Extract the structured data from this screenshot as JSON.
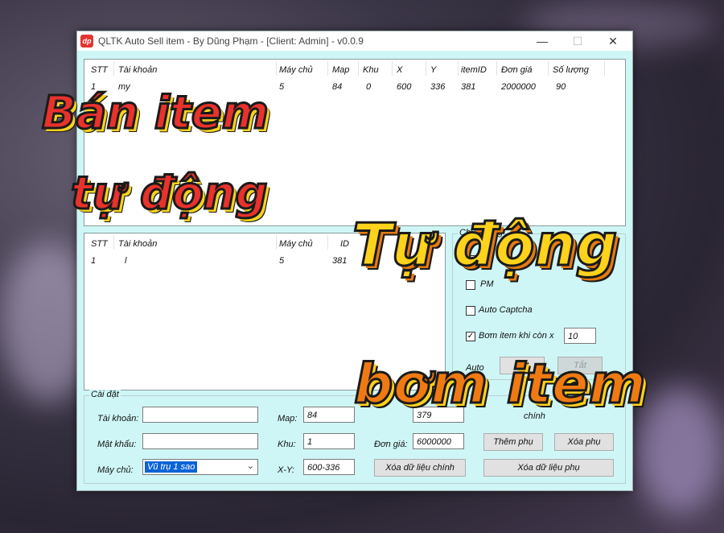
{
  "window": {
    "title": "QLTK Auto Sell item - By Dũng Phạm - [Client: Admin] - v0.0.9",
    "icon_label": "dp",
    "minimize": "—",
    "maximize": "☐",
    "close": "✕"
  },
  "top_list": {
    "columns": [
      "STT",
      "Tài khoản",
      "Máy chủ",
      "Map",
      "Khu",
      "X",
      "Y",
      "itemID",
      "Đơn giá",
      "Số lượng"
    ],
    "rows": [
      [
        "1",
        "my",
        "5",
        "84",
        "0",
        "600",
        "336",
        "381",
        "2000000",
        "90"
      ]
    ]
  },
  "bottom_list": {
    "columns": [
      "STT",
      "Tài khoản",
      "Máy chủ",
      "ID"
    ],
    "rows": [
      [
        "1",
        "l",
        "5",
        "381"
      ]
    ]
  },
  "features": {
    "group_label": "Chức năng",
    "checkboxes": [
      {
        "label": "Ch",
        "checked": true
      },
      {
        "label": "PM",
        "checked": false
      },
      {
        "label": "Auto Captcha",
        "checked": false
      },
      {
        "label": "Bơm item khi còn x",
        "checked": true
      }
    ],
    "pump_threshold": "10",
    "auto_label": "Auto",
    "on_button": "Bật",
    "off_button": "Tắt"
  },
  "settings": {
    "group_label": "Cài đặt",
    "account_label": "Tài khoản:",
    "account_value": "",
    "password_label": "Mật khẩu:",
    "password_value": "",
    "server_label": "Máy chủ:",
    "server_value": "Vũ trụ 1 sao",
    "map_label": "Map:",
    "map_value": "84",
    "zone_label": "Khu:",
    "zone_value": "1",
    "xy_label": "X-Y:",
    "xy_value": "600-336",
    "itemid_value": "379",
    "price_label": "Đơn giá:",
    "price_value": "6000000",
    "main_hidden_label": "chính",
    "add_sub_button": "Thêm phụ",
    "delete_sub_button": "Xóa phụ",
    "clear_main_button": "Xóa dữ liệu chính",
    "clear_sub_button": "Xóa dữ liệu phụ"
  },
  "overlay": {
    "line1": "Bán item",
    "line2": "tự động",
    "line3": "Tự động",
    "line4": "bơm item"
  },
  "colors": {
    "window_bg": "#cff6f6",
    "overlay_red": "#e8322c",
    "overlay_yellow": "#ffd21c",
    "overlay_orange": "#f07a12",
    "icon_red": "#e3342f"
  }
}
